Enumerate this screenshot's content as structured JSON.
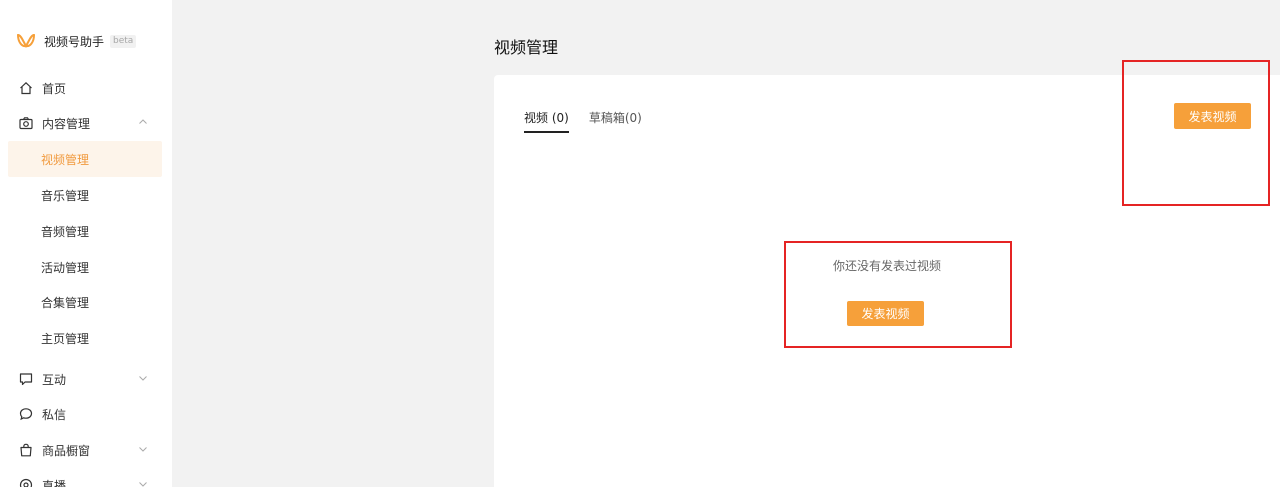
{
  "app": {
    "name": "视频号助手",
    "badge": "beta"
  },
  "nav": {
    "home": "首页",
    "content": "内容管理",
    "content_sub": [
      "视频管理",
      "音乐管理",
      "音频管理",
      "活动管理",
      "合集管理",
      "主页管理"
    ],
    "interaction": "互动",
    "messages": "私信",
    "shop": "商品橱窗",
    "live": "直播"
  },
  "main": {
    "title": "视频管理",
    "tabs": [
      "视频 (0)",
      "草稿箱(0)"
    ],
    "publish_button": "发表视频",
    "empty_text": "你还没有发表过视频",
    "empty_button": "发表视频"
  },
  "colors": {
    "accent": "#f6a03a",
    "active_bg": "#fdf4ea",
    "highlight": "#e52424"
  },
  "icons": [
    "logo-icon",
    "home-icon",
    "camera-icon",
    "chevron-up-icon",
    "chat-bubble-icon",
    "message-circle-icon",
    "bag-icon",
    "live-icon",
    "chevron-down-icon"
  ]
}
